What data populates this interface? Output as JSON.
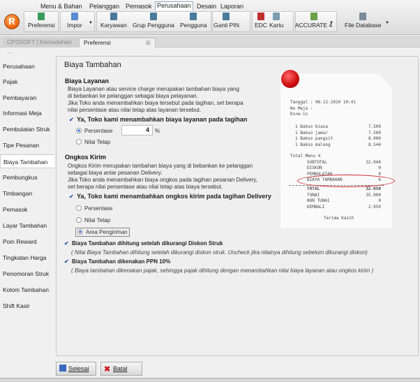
{
  "menu": [
    "Menu & Bahan",
    "Pelanggan",
    "Pemasok",
    "Perusahaan",
    "Desain",
    "Laporan"
  ],
  "active_menu": "Perusahaan",
  "toolbar": {
    "preferensi": "Preferensi",
    "impor": "Impor",
    "karyawan": "Karyawan",
    "grup_pengguna": "Grup Pengguna",
    "pengguna": "Pengguna",
    "ganti_pin": "Ganti PIN",
    "edc": "EDC",
    "kartu": "Kartu",
    "accurate": "ACCURATE 4",
    "file_database": "File Database"
  },
  "tabs": [
    {
      "label": "CPSSOFT | Kemudahan ..."
    },
    {
      "label": "Preferensi"
    }
  ],
  "sidebar": {
    "items": [
      "Perusahaan",
      "Pajak",
      "Pembayaran",
      "Informasi Meja",
      "Pembulatan Struk",
      "Tipe Pesanan",
      "Biaya Tambahan",
      "Pembungkus",
      "Timbangan",
      "Pemasok",
      "Layar Tambahan",
      "Poin Reward",
      "Tingkatan Harga",
      "Penomoran Struk",
      "Kolom Tambahan",
      "Shift Kasir"
    ],
    "active": "Biaya Tambahan"
  },
  "main": {
    "title": "Biaya Tambahan",
    "layanan": {
      "heading": "Biaya Layanan",
      "desc": [
        "Biaya Layanan atau service charge merupakan tambahan biaya yang",
        "di bebankan ke pelanggan sebagai biaya pelayanan.",
        "Jika Toko anda menambahkan biaya tersebut pada tagihan, set berapa",
        "nilai persentase atau nilai tetap atas layanan tersebut."
      ],
      "check": "Ya, Toko kami menambahkan biaya layanan pada tagihan",
      "checked": true,
      "opt_persen": "Persentase",
      "persen_value": "4",
      "unit": "%",
      "opt_tetap": "Nilai Tetap",
      "selected": "Persentase"
    },
    "kirim": {
      "heading": "Ongkos Kirim",
      "desc": [
        "Ongkos Kirim merupakan tambahan biaya yang di bebankan ke pelanggan",
        "sebagai biaya antar pesanan Delivery.",
        "Jika Toko anda menambahkan biaya ongkos pada tagihan pesanan Delivery,",
        "set berapa nilai persentase atau nilai tetap atas biaya tersebut."
      ],
      "check": "Ya, Toko kami menambahkan ongkos kirim pada tagihan Delivery",
      "checked": true,
      "opt_persen": "Persentase",
      "opt_tetap": "Nilai Tetap",
      "opt_area": "Area Pengiriman",
      "selected": "Area Pengiriman"
    },
    "diskon": {
      "label": "Biaya Tambahan dihitung setelah dikurangi Diskon Struk",
      "note": "( Nilai Biaya Tambahan dihitung setelah dikurangi diskon struk. Uncheck jika nilainya dihitung sebelum dikurangi diskon)",
      "checked": true
    },
    "ppn": {
      "label": "Biaya Tambahan dikenakan PPN 10%",
      "note": "( Biaya tambahan dikenakan pajak, sehingga pajak dihitung dengan menambahkan nilai biaya layanan atau ongkos kirim )",
      "checked": true
    }
  },
  "receipt": {
    "header": [
      "Tanggal : 06-12-2010 10:41",
      "No Meja :",
      "Dine-in"
    ],
    "items": [
      [
        "1 Bakso biasa",
        "7.500"
      ],
      [
        "1 Bakso jamur",
        "7.500"
      ],
      [
        "1 Bakso pangsit",
        "8.000"
      ],
      [
        "1 Bakso malang",
        "8.544"
      ]
    ],
    "total_menu": "Total Menu 4",
    "sums": [
      [
        "SUBTOTAL",
        "32.044"
      ],
      [
        "DISKON",
        "0"
      ],
      [
        "PEMBULATAN",
        "0"
      ],
      [
        "BIAYA TAMBAHAN",
        "6"
      ]
    ],
    "totals": [
      [
        "TOTAL",
        "32.050"
      ],
      [
        "TUNAI",
        "35.000"
      ],
      [
        "NON TUNAI",
        "0"
      ],
      [
        "KEMBALI",
        "2.950"
      ]
    ],
    "footer": "Terima Kasih"
  },
  "buttons": {
    "selesai": "Selesai",
    "batal": "Batal"
  }
}
